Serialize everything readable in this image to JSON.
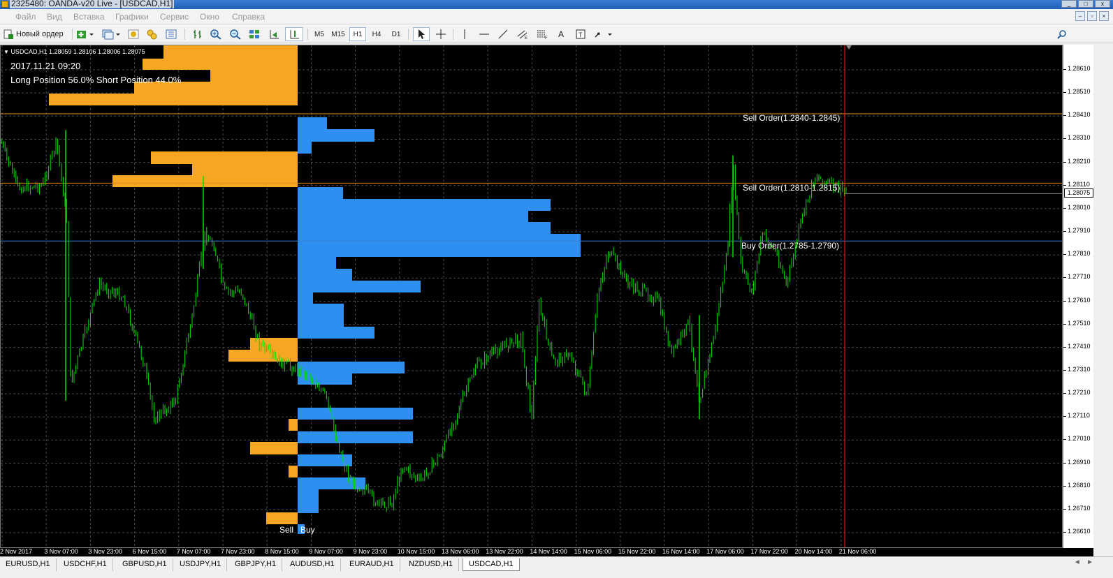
{
  "window": {
    "title": "2325480: OANDA-v20 Live - [USDCAD,H1]"
  },
  "menu": [
    "Файл",
    "Вид",
    "Вставка",
    "Графики",
    "Сервис",
    "Окно",
    "Справка"
  ],
  "toolbar": {
    "new_order": "Новый ордер",
    "timeframes": [
      "M5",
      "M15",
      "H1",
      "H4",
      "D1"
    ],
    "selected_timeframe": "H1"
  },
  "chart": {
    "ohlc": "USDCAD,H1  1.28059 1.28106 1.28006 1.28075",
    "datetime": "2017.11.21 09:20",
    "position": "Long Position 56.0% Short Position 44.0%",
    "orders": [
      {
        "label": "Sell Order(1.2840-1.2845)",
        "price": 1.2842,
        "color": "#e08a1e"
      },
      {
        "label": "Sell Order(1.2810-1.2815)",
        "price": 1.2812,
        "color": "#e08a1e"
      },
      {
        "label": "Buy Order(1.2785-1.2790)",
        "price": 1.2787,
        "color": "#3a7fd0"
      }
    ],
    "sell_label": "Sell",
    "buy_label": "Buy",
    "current_price": "1.28075",
    "colors": {
      "background": "#000000",
      "grid": "#4a4a4a",
      "candles": "#00e000",
      "sell": "#f5a623",
      "buy": "#2d8ff0",
      "vline": "#ff2020"
    }
  },
  "price_scale": [
    "1.28610",
    "1.28510",
    "1.28410",
    "1.28310",
    "1.28210",
    "1.28110",
    "1.28010",
    "1.27910",
    "1.27810",
    "1.27710",
    "1.27610",
    "1.27510",
    "1.27410",
    "1.27310",
    "1.27210",
    "1.27110",
    "1.27010",
    "1.26910",
    "1.26810",
    "1.26710",
    "1.26610"
  ],
  "time_scale": [
    "2 Nov 2017",
    "3 Nov 07:00",
    "3 Nov 23:00",
    "6 Nov 15:00",
    "7 Nov 07:00",
    "7 Nov 23:00",
    "8 Nov 15:00",
    "9 Nov 07:00",
    "9 Nov 23:00",
    "10 Nov 15:00",
    "13 Nov 06:00",
    "13 Nov 22:00",
    "14 Nov 14:00",
    "15 Nov 06:00",
    "15 Nov 22:00",
    "16 Nov 14:00",
    "17 Nov 06:00",
    "17 Nov 22:00",
    "20 Nov 14:00",
    "21 Nov 06:00"
  ],
  "tabs": [
    "EURUSD,H1",
    "USDCHF,H1",
    "GBPUSD,H1",
    "USDJPY,H1",
    "GBPJPY,H1",
    "AUDUSD,H1",
    "EURAUD,H1",
    "NZDUSD,H1",
    "USDCAD,H1"
  ],
  "active_tab": "USDCAD,H1"
}
